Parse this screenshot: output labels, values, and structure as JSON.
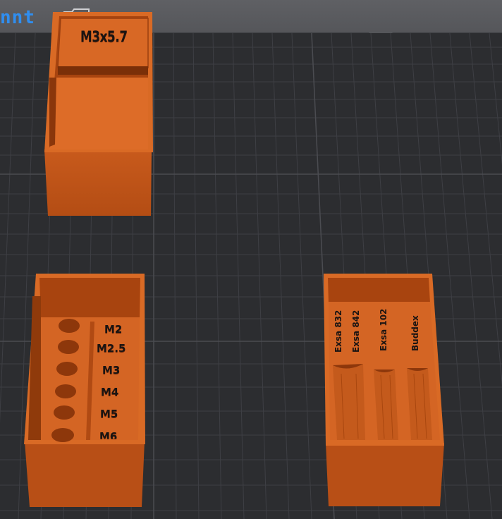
{
  "app": {
    "brand_text": "nnt",
    "brand_icon": "folder-icon"
  },
  "models": {
    "box_top": {
      "label": "M3x5.7"
    },
    "box_screws": {
      "labels": [
        "M2",
        "M2.5",
        "M3",
        "M4",
        "M5",
        "M6"
      ]
    },
    "box_batteries": {
      "labels": [
        "Exsa 832",
        "Exsa 842",
        "Exsa 102",
        "Buddex"
      ]
    }
  },
  "colors": {
    "filament": "#d4631f",
    "bed": "#2c2d30",
    "grid": "#3d3e42",
    "accent": "#2f8ef0"
  }
}
